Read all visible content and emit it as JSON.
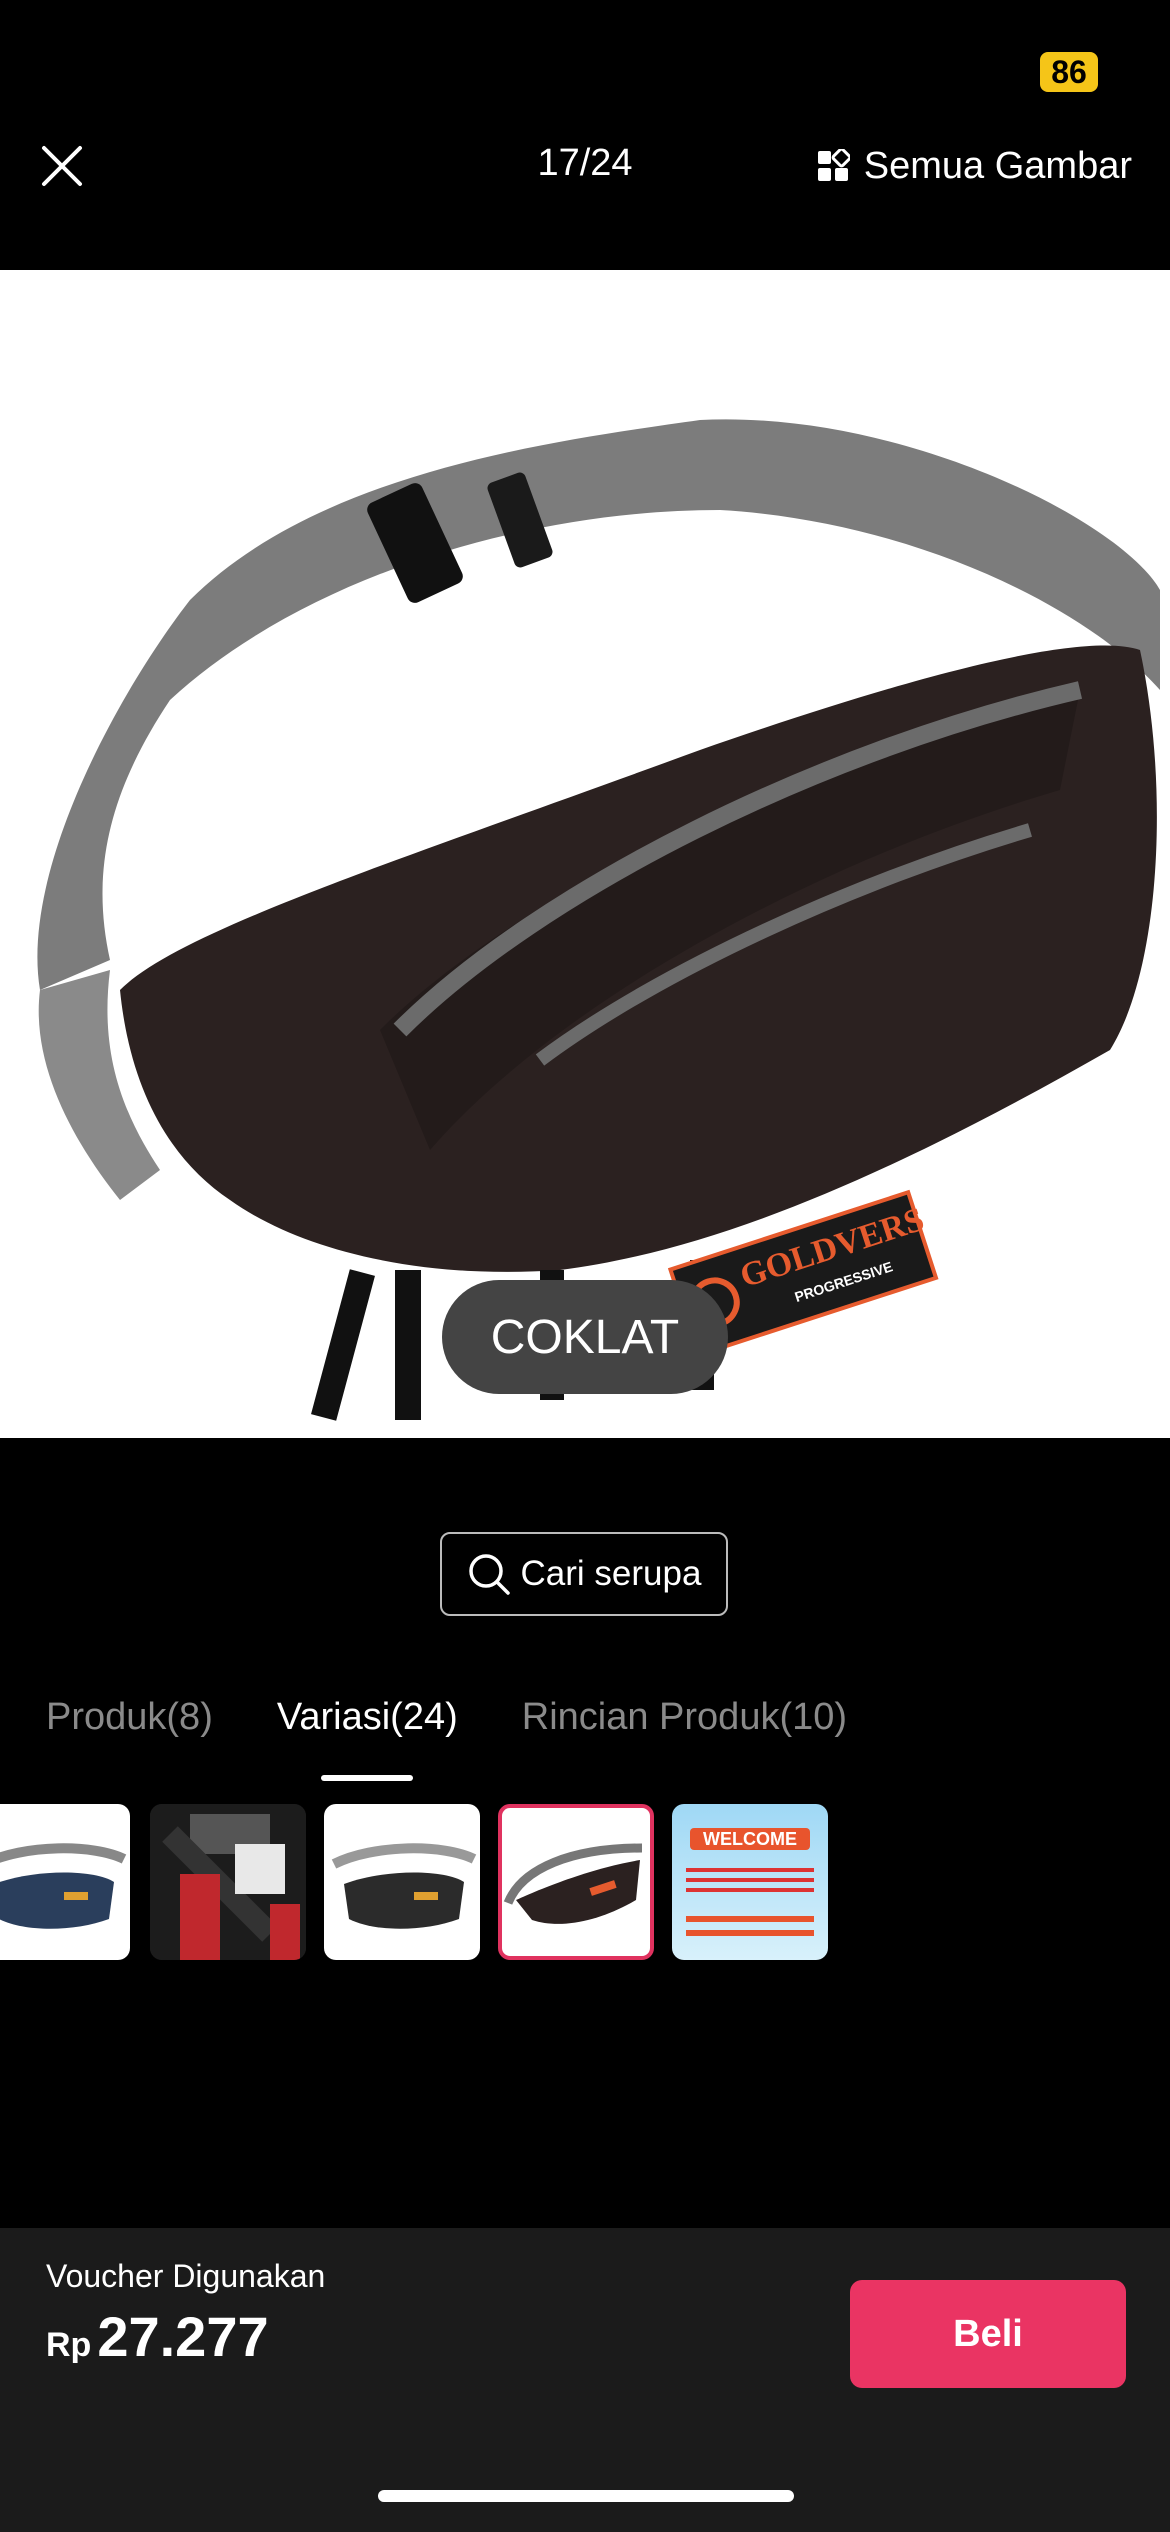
{
  "status": {
    "battery": "86"
  },
  "header": {
    "counter": "17/24",
    "all_images_label": "Semua Gambar"
  },
  "product_image": {
    "variant_label": "COKLAT",
    "logo_brand": "GOLDVERS",
    "logo_sub": "PROGRESSIVE"
  },
  "similar": {
    "label": "Cari serupa"
  },
  "tabs": [
    {
      "label": "Produk(8)",
      "active": false
    },
    {
      "label": "Variasi(24)",
      "active": true
    },
    {
      "label": "Rincian Produk(10)",
      "active": false
    }
  ],
  "thumbnails": [
    {
      "name": "thumb-navy-bag"
    },
    {
      "name": "thumb-model-wearing"
    },
    {
      "name": "thumb-black-bag"
    },
    {
      "name": "thumb-brown-bag",
      "selected": true
    },
    {
      "name": "thumb-welcome-banner",
      "text": "WELCOME"
    }
  ],
  "bottom": {
    "voucher_label": "Voucher Digunakan",
    "currency": "Rp",
    "price": "27.277",
    "buy_label": "Beli"
  },
  "colors": {
    "accent": "#ea3463",
    "background": "#000000",
    "pill": "#444444"
  }
}
